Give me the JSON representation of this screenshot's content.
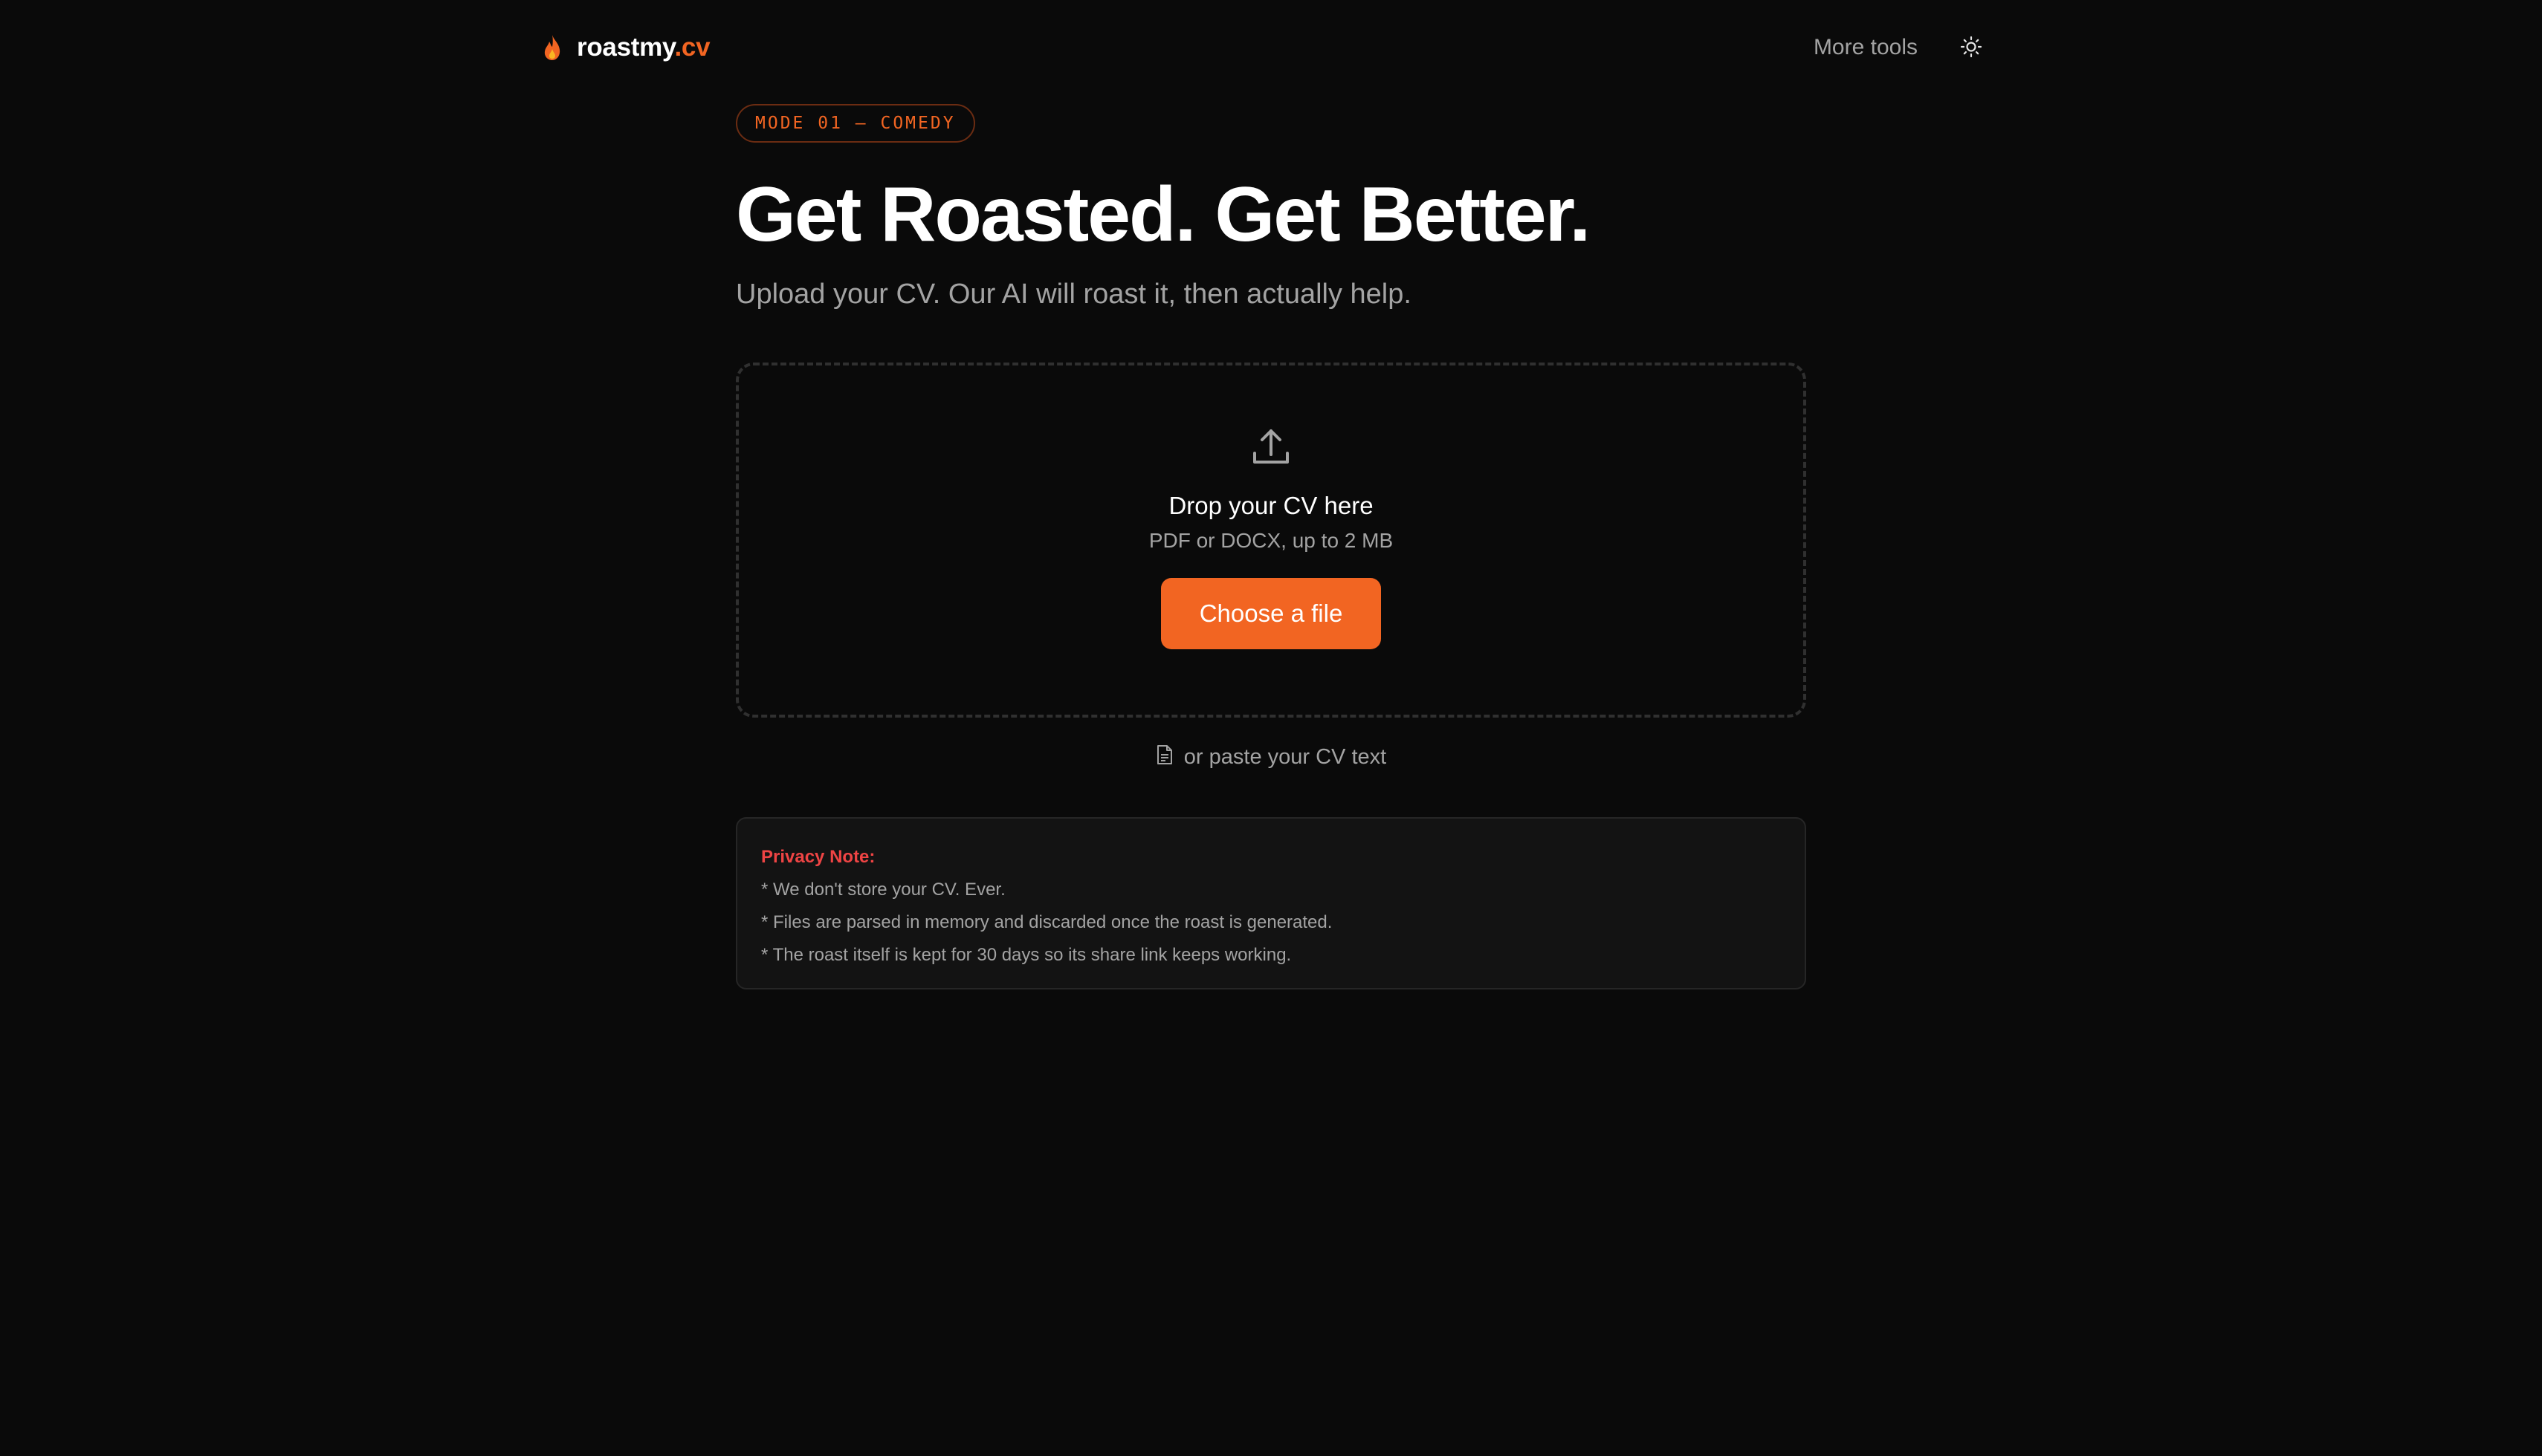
{
  "header": {
    "brand_name": "roastmy",
    "brand_tld": ".cv",
    "more_tools": "More tools",
    "icons": {
      "brand": "flame-icon",
      "theme": "sun-icon"
    }
  },
  "hero": {
    "mode_badge": "MODE 01 — COMEDY",
    "title": "Get Roasted. Get Better.",
    "subtitle": "Upload your CV. Our AI will roast it, then actually help."
  },
  "dropzone": {
    "icon": "upload-icon",
    "title": "Drop your CV here",
    "subtitle": "PDF or DOCX, up to 2 MB",
    "button_label": "Choose a file"
  },
  "paste": {
    "icon": "document-icon",
    "label": "or paste your CV text"
  },
  "privacy": {
    "title": "Privacy Note:",
    "lines": [
      "* We don't store your CV. Ever.",
      "* Files are parsed in memory and discarded once the roast is generated.",
      "* The roast itself is kept for 30 days so its share link keeps working."
    ]
  },
  "colors": {
    "background": "#0a0a0a",
    "accent": "#f26522",
    "privacy_title": "#ef4444",
    "muted_text": "#a3a3a3"
  }
}
